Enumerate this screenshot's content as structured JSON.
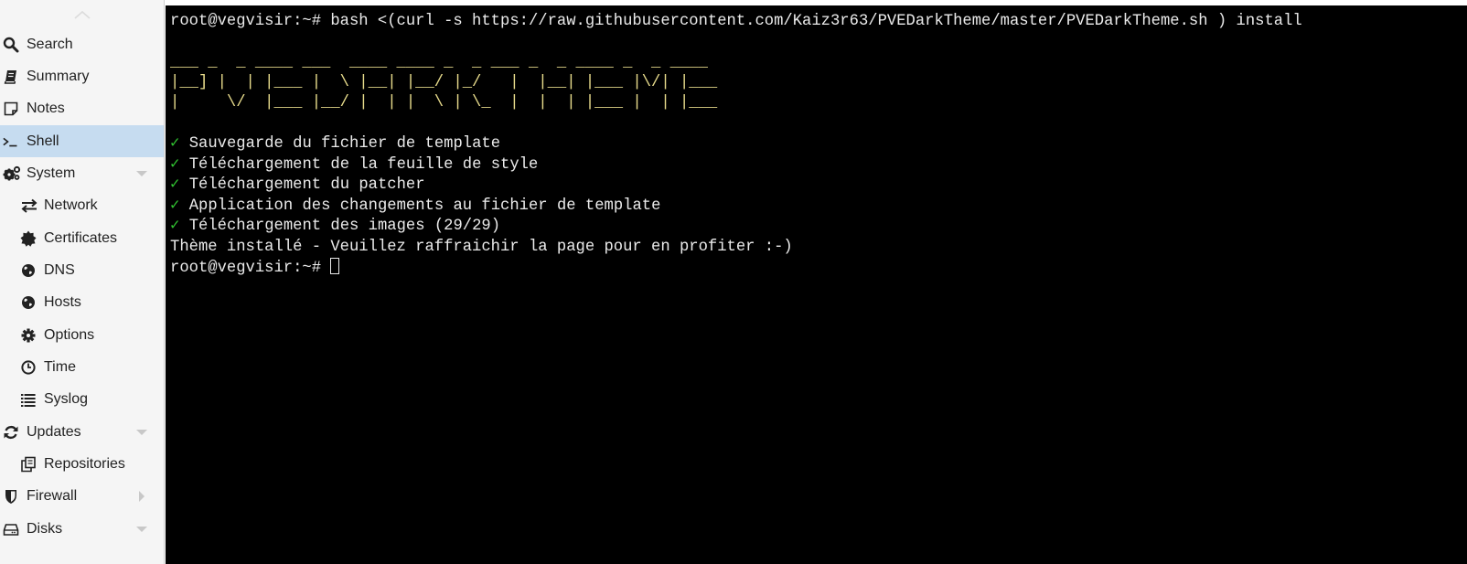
{
  "sidebar": {
    "items": [
      {
        "label": "Search",
        "icon": "search-icon"
      },
      {
        "label": "Summary",
        "icon": "book-icon"
      },
      {
        "label": "Notes",
        "icon": "note-icon"
      },
      {
        "label": "Shell",
        "icon": "terminal-icon",
        "selected": true
      },
      {
        "label": "System",
        "icon": "gears-icon",
        "expander": "chevron-down-icon"
      },
      {
        "label": "Network",
        "icon": "exchange-icon"
      },
      {
        "label": "Certificates",
        "icon": "certificate-icon"
      },
      {
        "label": "DNS",
        "icon": "globe-icon"
      },
      {
        "label": "Hosts",
        "icon": "globe-icon"
      },
      {
        "label": "Options",
        "icon": "gear-icon"
      },
      {
        "label": "Time",
        "icon": "clock-icon"
      },
      {
        "label": "Syslog",
        "icon": "list-icon"
      },
      {
        "label": "Updates",
        "icon": "refresh-icon",
        "expander": "chevron-down-icon"
      },
      {
        "label": "Repositories",
        "icon": "copy-icon"
      },
      {
        "label": "Firewall",
        "icon": "shield-icon",
        "expander": "chevron-right-icon"
      },
      {
        "label": "Disks",
        "icon": "hdd-icon",
        "expander": "chevron-down-icon"
      }
    ]
  },
  "terminal": {
    "command": {
      "prompt": "root@vegvisir:~# ",
      "text": "bash <(curl -s https://raw.githubusercontent.com/Kaiz3r63/PVEDarkTheme/master/PVEDarkTheme.sh ) install"
    },
    "ascii_art": [
      "___ _  _ ____ ___  ____ ____ _  _ ___ _  _ ____ _  _ ____",
      "|__] |  | |___ |  \\ |__| |__/ |_/   |  |__| |___ |\\/| |___",
      "|     \\/  |___ |__/ |  | |  \\ | \\_  |  |  | |___ |  | |___"
    ],
    "check_mark": "✓",
    "steps": [
      "Sauvegarde du fichier de template",
      "Téléchargement de la feuille de style",
      "Téléchargement du patcher",
      "Application des changements au fichier de template",
      "Téléchargement des images (29/29)"
    ],
    "final_message": "Thème installé - Veuillez raffraichir la page pour en profiter :-)",
    "final_prompt": "root@vegvisir:~# "
  }
}
